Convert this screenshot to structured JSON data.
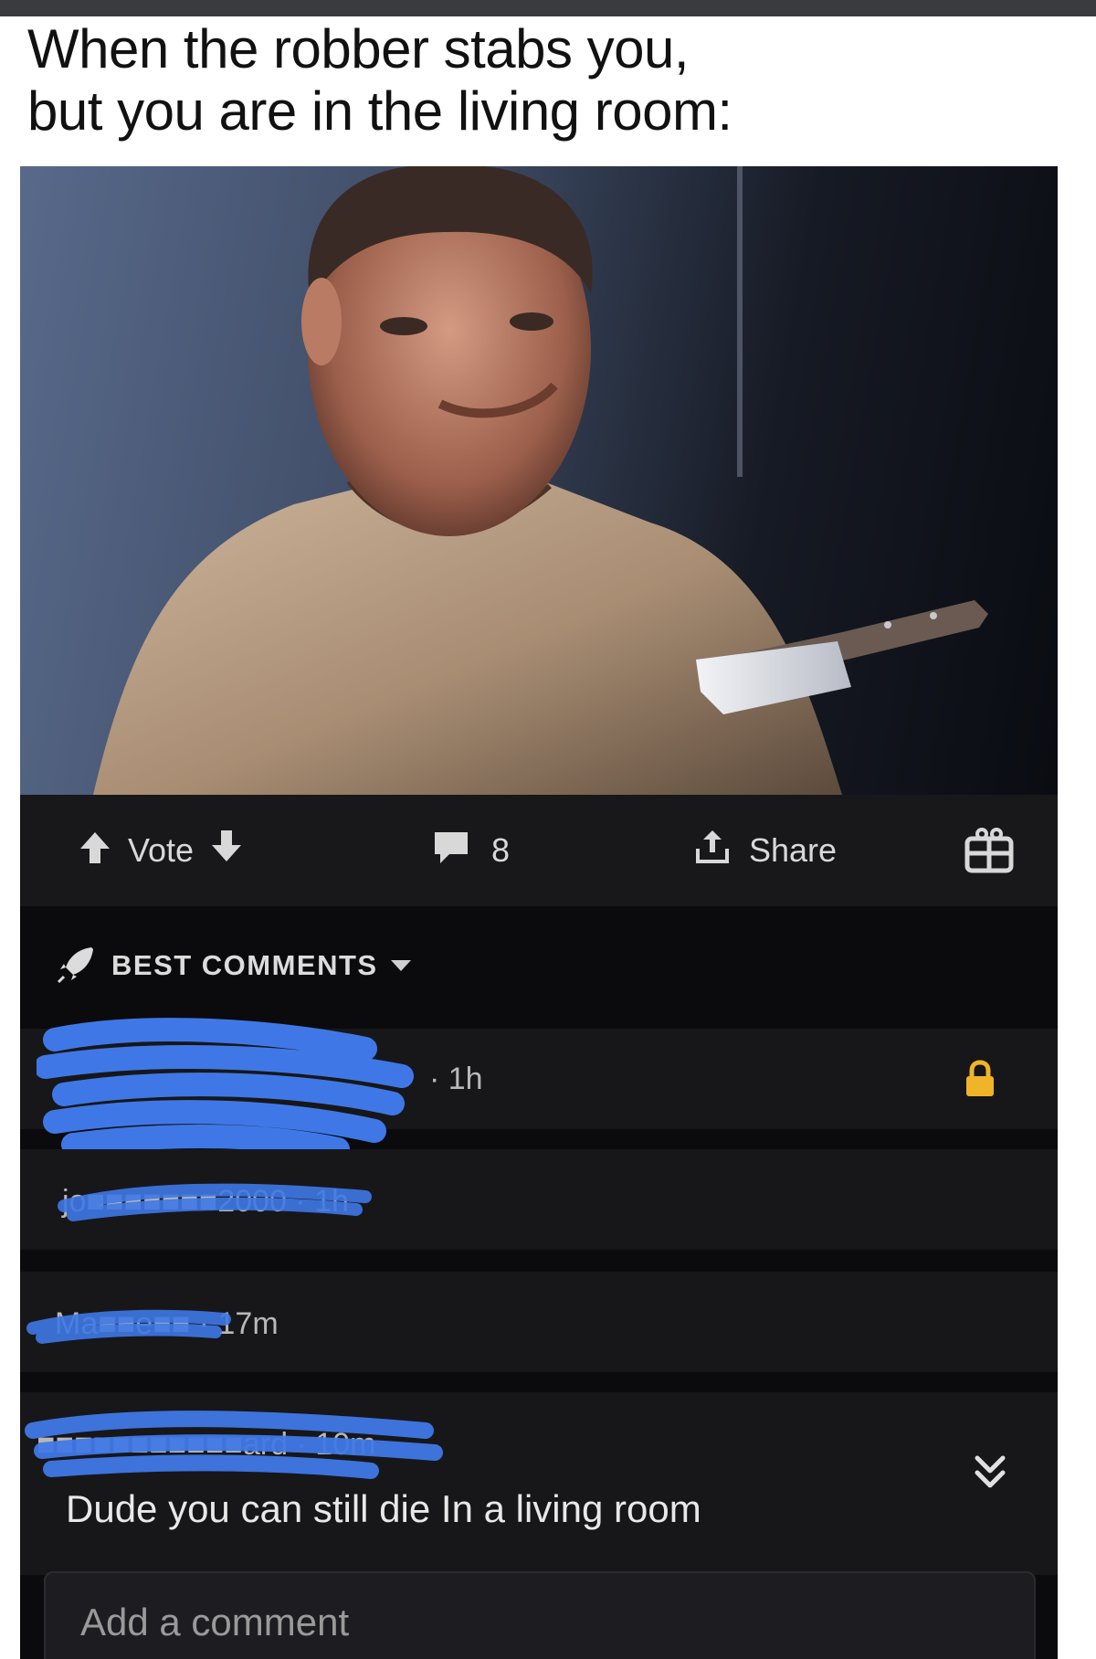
{
  "caption": {
    "line1": "When the robber stabs you,",
    "line2": "but you are in the living room:"
  },
  "photo": {
    "alt_icon": "meme-photo"
  },
  "actions": {
    "vote_label": "Vote",
    "comment_count": "8",
    "share_label": "Share",
    "upvote_icon": "arrow-up-icon",
    "downvote_icon": "arrow-down-icon",
    "comment_icon": "comment-bubble-icon",
    "share_icon": "share-icon",
    "gift_icon": "gift-icon"
  },
  "sort": {
    "label": "BEST COMMENTS",
    "icon": "rocket-icon"
  },
  "comments": [
    {
      "meta": "· 1h",
      "locked": true
    },
    {
      "meta": "jo■■■■■■■2000 · 1h"
    },
    {
      "meta": "Ma■■e■■ · 17m"
    },
    {
      "meta": "■■■■■■■■■■■ard · 10m",
      "text": "Dude you can still die In a living room"
    }
  ],
  "add_comment": {
    "placeholder": "Add a comment"
  },
  "colors": {
    "scribble": "#3f78e6",
    "lock": "#f0b429",
    "background_dark": "#0b0b0d",
    "card": "#17171a"
  }
}
